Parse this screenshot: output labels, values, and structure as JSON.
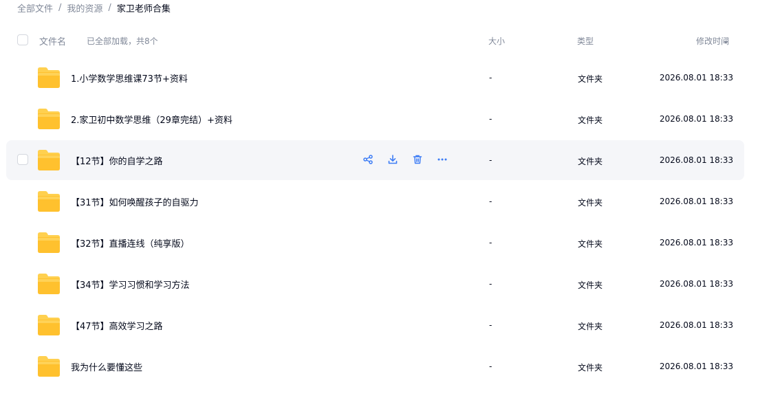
{
  "breadcrumb": {
    "items": [
      "全部文件",
      "我的资源",
      "家卫老师合集"
    ],
    "separator": "/"
  },
  "list_header": {
    "name_label": "文件名",
    "loaded_text": "已全部加载，共8个",
    "size_label": "大小",
    "type_label": "类型",
    "modified_label": "修改时间"
  },
  "files": [
    {
      "name": "1.小学数学思维课73节+资料",
      "size": "-",
      "type": "文件夹",
      "modified": "2026.08.01 18:33"
    },
    {
      "name": "2.家卫初中数学思维（29章完结）+资料",
      "size": "-",
      "type": "文件夹",
      "modified": "2026.08.01 18:33"
    },
    {
      "name": "【12节】你的自学之路",
      "size": "-",
      "type": "文件夹",
      "modified": "2026.08.01 18:33",
      "hovered": true
    },
    {
      "name": "【31节】如何唤醒孩子的自驱力",
      "size": "-",
      "type": "文件夹",
      "modified": "2026.08.01 18:33"
    },
    {
      "name": "【32节】直播连线（纯享版）",
      "size": "-",
      "type": "文件夹",
      "modified": "2026.08.01 18:33"
    },
    {
      "name": "【34节】学习习惯和学习方法",
      "size": "-",
      "type": "文件夹",
      "modified": "2026.08.01 18:33"
    },
    {
      "name": "【47节】高效学习之路",
      "size": "-",
      "type": "文件夹",
      "modified": "2026.08.01 18:33"
    },
    {
      "name": "我为什么要懂这些",
      "size": "-",
      "type": "文件夹",
      "modified": "2026.08.01 18:33"
    }
  ],
  "row_actions": [
    "share-icon",
    "download-icon",
    "delete-icon",
    "more-icon"
  ],
  "colors": {
    "accent": "#3d7cf5",
    "folder_top": "#ffd04f",
    "folder_body": "#ffc12e",
    "hover_row": "#f5f6f9",
    "muted_text": "#818999"
  }
}
